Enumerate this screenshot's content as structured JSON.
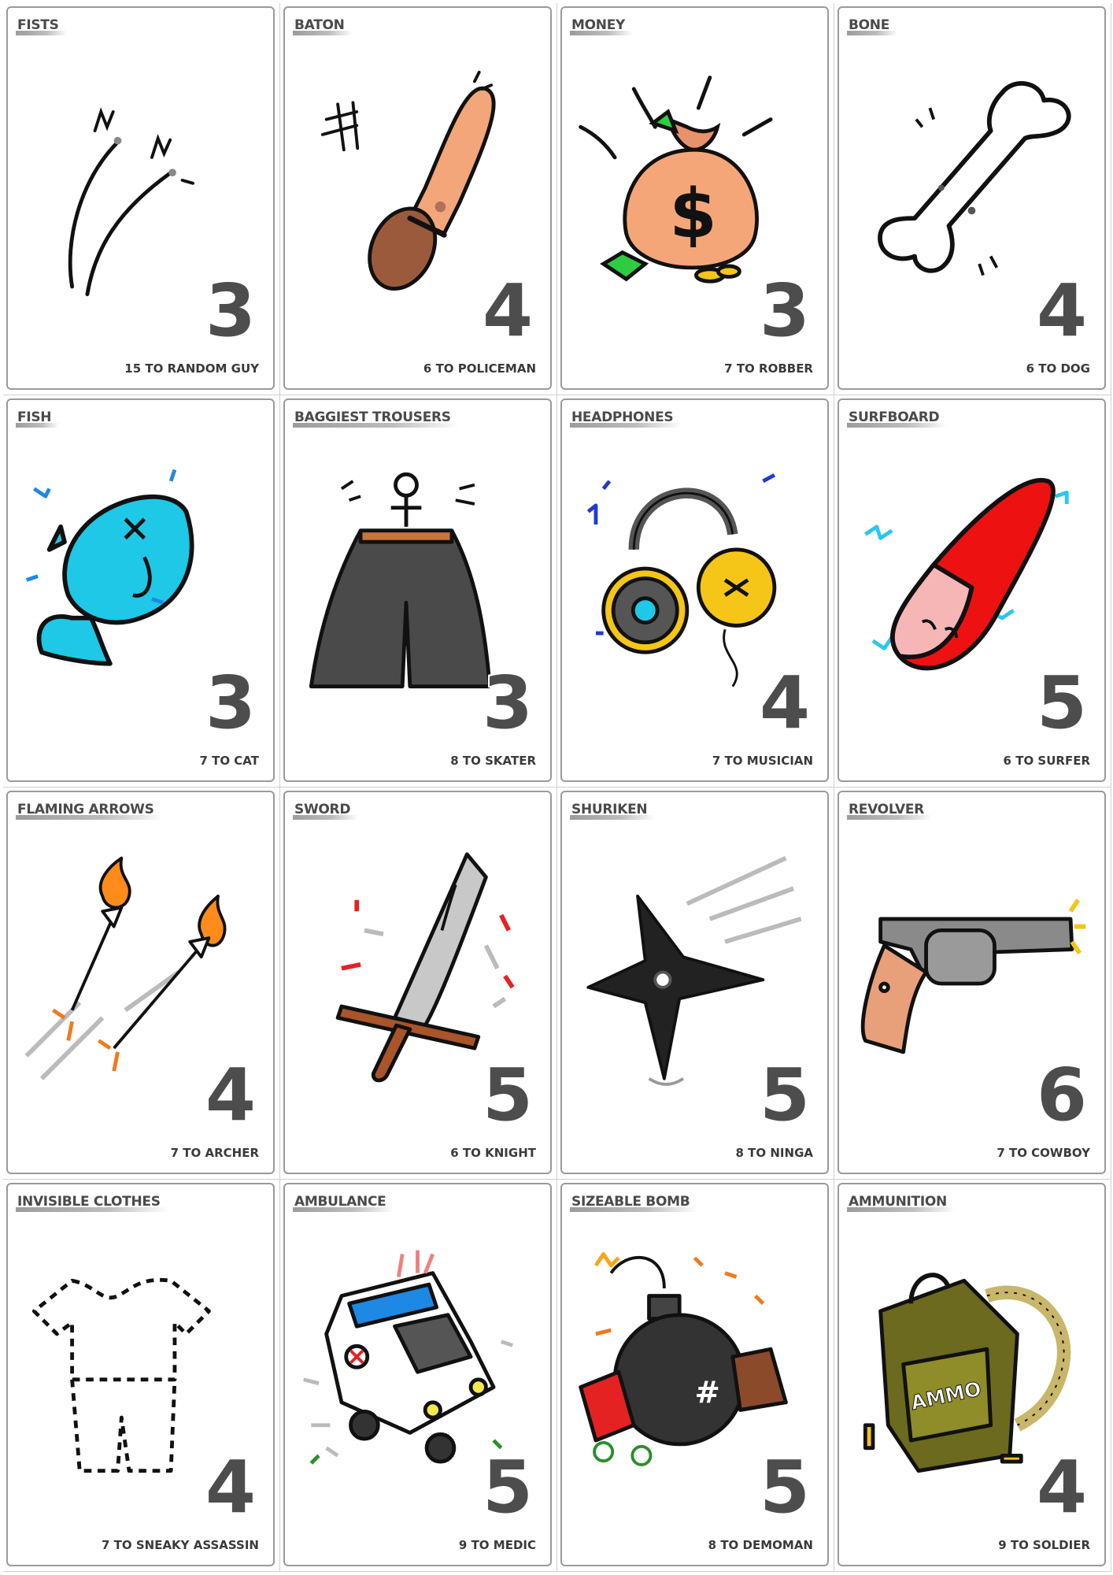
{
  "cards": [
    {
      "id": "fists",
      "title": "FISTS",
      "value": "3",
      "bonus": "15 TO RANDOM GUY"
    },
    {
      "id": "baton",
      "title": "BATON",
      "value": "4",
      "bonus": "6 TO POLICEMAN"
    },
    {
      "id": "money",
      "title": "MONEY",
      "value": "3",
      "bonus": "7 TO ROBBER"
    },
    {
      "id": "bone",
      "title": "BONE",
      "value": "4",
      "bonus": "6 TO DOG"
    },
    {
      "id": "fish",
      "title": "FISH",
      "value": "3",
      "bonus": "7 TO CAT"
    },
    {
      "id": "baggiest-trousers",
      "title": "BAGGIEST TROUSERS",
      "value": "3",
      "bonus": "8 TO SKATER"
    },
    {
      "id": "headphones",
      "title": "HEADPHONES",
      "value": "4",
      "bonus": "7 TO MUSICIAN"
    },
    {
      "id": "surfboard",
      "title": "SURFBOARD",
      "value": "5",
      "bonus": "6 TO SURFER"
    },
    {
      "id": "flaming-arrows",
      "title": "FLAMING ARROWS",
      "value": "4",
      "bonus": "7 TO ARCHER"
    },
    {
      "id": "sword",
      "title": "SWORD",
      "value": "5",
      "bonus": "6 TO KNIGHT"
    },
    {
      "id": "shuriken",
      "title": "SHURIKEN",
      "value": "5",
      "bonus": "8 TO NINGA"
    },
    {
      "id": "revolver",
      "title": "REVOLVER",
      "value": "6",
      "bonus": "7 TO COWBOY"
    },
    {
      "id": "invisible-clothes",
      "title": "INVISIBLE CLOTHES",
      "value": "4",
      "bonus": "7 TO SNEAKY ASSASSIN"
    },
    {
      "id": "ambulance",
      "title": "AMBULANCE",
      "value": "5",
      "bonus": "9 TO MEDIC"
    },
    {
      "id": "sizeable-bomb",
      "title": "SIZEABLE BOMB",
      "value": "5",
      "bonus": "8 TO DEMOMAN"
    },
    {
      "id": "ammunition",
      "title": "AMMUNITION",
      "value": "4",
      "bonus": "9 TO SOLDIER"
    }
  ],
  "illustration_text": {
    "money_symbol": "$",
    "ammo_label": "AMMO",
    "bomb_mark": "#"
  },
  "colors": {
    "title_text": "#4a4a4a",
    "value_text": "#4d4d4d",
    "card_border": "#9a9a9a",
    "baton": "#f2a679",
    "money_bag": "#f5a679",
    "fish": "#1ec8e6",
    "trousers": "#4a4a4a",
    "headphone_yellow": "#f5c518",
    "surfboard_red": "#ee1111",
    "flame": "#ff8c1a",
    "sword_blade": "#c8c8c8",
    "shuriken": "#222222",
    "revolver": "#8a8a8a",
    "ambulance_blue": "#1e88e5",
    "bomb": "#333333",
    "ammo_box": "#6b6a1e"
  }
}
